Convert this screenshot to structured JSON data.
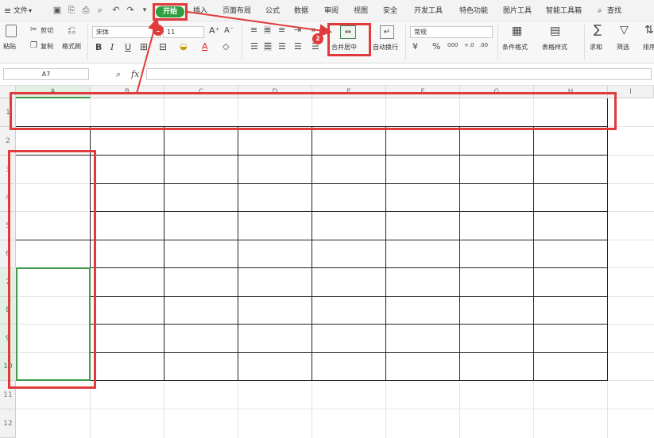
{
  "menubar": {
    "hamburger": "≡",
    "file_label": "文件",
    "file_arrow": "▾",
    "tabs": [
      "开始",
      "插入",
      "页面布局",
      "公式",
      "数据",
      "审阅",
      "视图",
      "安全",
      "开发工具",
      "特色功能",
      "图片工具",
      "智能工具箱"
    ],
    "search_label": "查找"
  },
  "ribbon": {
    "paste_label": "粘贴",
    "cut_label": "剪切",
    "copy_label": "复制",
    "format_painter_label": "格式刷",
    "font_name": "宋体",
    "font_size": "11",
    "merge_center_label": "合并居中",
    "wrap_text_label": "自动换行",
    "number_format": "常规",
    "conditional_format_label": "条件格式",
    "table_style_label": "表格样式",
    "sum_label": "求和",
    "filter_label": "筛选",
    "sort_label": "排序",
    "percent_symbol": "%",
    "thousands_symbol": "000",
    "inc_decimal_symbol": "+.0",
    "dec_decimal_symbol": ".00",
    "bold_glyph": "B",
    "italic_glyph": "I",
    "underline_glyph": "U",
    "grow_font_glyph": "A⁺",
    "shrink_font_glyph": "A⁻",
    "font_color_glyph": "A"
  },
  "formula_bar": {
    "cell_ref": "A7",
    "fx_label": "fx"
  },
  "grid": {
    "columns": [
      "A",
      "B",
      "C",
      "D",
      "E",
      "F",
      "G",
      "H",
      "I"
    ],
    "rows": [
      "1",
      "2",
      "3",
      "4",
      "5",
      "6",
      "7",
      "8",
      "9",
      "10",
      "11",
      "12"
    ]
  },
  "annotations": {
    "step1": "1",
    "step2": "2"
  },
  "colors": {
    "start_tab": "#2e9e3f",
    "annotation_red": "#e03a3a",
    "selection_green": "#3c9a48"
  }
}
